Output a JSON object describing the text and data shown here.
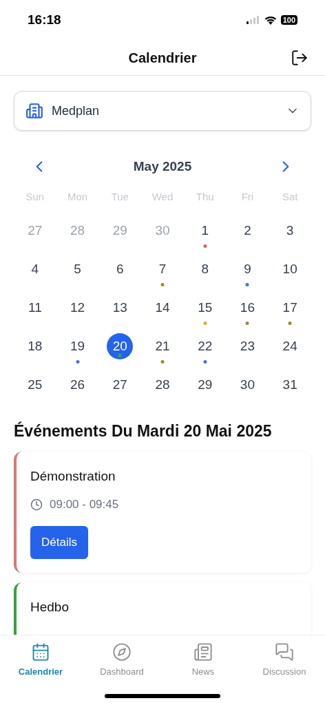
{
  "status_bar": {
    "time": "16:18",
    "battery": "100"
  },
  "header": {
    "title": "Calendrier"
  },
  "selector": {
    "value": "Medplan"
  },
  "calendar": {
    "month": "May 2025",
    "weekdays": [
      "Sun",
      "Mon",
      "Tue",
      "Wed",
      "Thu",
      "Fri",
      "Sat"
    ],
    "weeks": [
      [
        {
          "day": "27",
          "muted": true,
          "selected": false
        },
        {
          "day": "28",
          "muted": true,
          "selected": false
        },
        {
          "day": "29",
          "muted": true,
          "selected": false
        },
        {
          "day": "30",
          "muted": true,
          "selected": false
        },
        {
          "day": "1",
          "muted": false,
          "selected": false,
          "color": "#d9625f"
        },
        {
          "day": "2",
          "muted": false,
          "selected": false
        },
        {
          "day": "3",
          "muted": false,
          "selected": false
        }
      ],
      [
        {
          "day": "4",
          "muted": false,
          "selected": false
        },
        {
          "day": "5",
          "muted": false,
          "selected": false
        },
        {
          "day": "6",
          "muted": false,
          "selected": false
        },
        {
          "day": "7",
          "muted": false,
          "selected": false,
          "color": "#9a8a2e"
        },
        {
          "day": "8",
          "muted": false,
          "selected": false
        },
        {
          "day": "9",
          "muted": false,
          "selected": false,
          "color": "#4f6fe0"
        },
        {
          "day": "10",
          "muted": false,
          "selected": false
        }
      ],
      [
        {
          "day": "11",
          "muted": false,
          "selected": false
        },
        {
          "day": "12",
          "muted": false,
          "selected": false
        },
        {
          "day": "13",
          "muted": false,
          "selected": false
        },
        {
          "day": "14",
          "muted": false,
          "selected": false
        },
        {
          "day": "15",
          "muted": false,
          "selected": false,
          "color": "#f5a623"
        },
        {
          "day": "16",
          "muted": false,
          "selected": false,
          "color": "#9a8a2e"
        },
        {
          "day": "17",
          "muted": false,
          "selected": false,
          "color": "#9a8a2e"
        }
      ],
      [
        {
          "day": "18",
          "muted": false,
          "selected": false
        },
        {
          "day": "19",
          "muted": false,
          "selected": false,
          "color": "#4f6fe0"
        },
        {
          "day": "20",
          "muted": false,
          "selected": true,
          "color": "#34a853"
        },
        {
          "day": "21",
          "muted": false,
          "selected": false,
          "color": "#9a8a2e"
        },
        {
          "day": "22",
          "muted": false,
          "selected": false,
          "color": "#4f6fe0"
        },
        {
          "day": "23",
          "muted": false,
          "selected": false
        },
        {
          "day": "24",
          "muted": false,
          "selected": false
        }
      ],
      [
        {
          "day": "25",
          "muted": false,
          "selected": false
        },
        {
          "day": "26",
          "muted": false,
          "selected": false
        },
        {
          "day": "27",
          "muted": false,
          "selected": false
        },
        {
          "day": "28",
          "muted": false,
          "selected": false
        },
        {
          "day": "29",
          "muted": false,
          "selected": false
        },
        {
          "day": "30",
          "muted": false,
          "selected": false
        },
        {
          "day": "31",
          "muted": false,
          "selected": false
        }
      ]
    ]
  },
  "events": {
    "heading": "Événements Du Mardi 20 Mai 2025",
    "items": [
      {
        "title": "Démonstration",
        "time": "09:00 - 09:45",
        "button": "Détails",
        "color": "#d47a78"
      },
      {
        "title": "Hedbo",
        "color": "#3aa040"
      }
    ]
  },
  "tab_bar": [
    {
      "label": "Calendrier",
      "selected": true,
      "kind": "calendar"
    },
    {
      "label": "Dashboard",
      "selected": false,
      "kind": "compass"
    },
    {
      "label": "News",
      "selected": false,
      "kind": "newspaper"
    },
    {
      "label": "Discussion",
      "selected": false,
      "kind": "chat"
    }
  ]
}
